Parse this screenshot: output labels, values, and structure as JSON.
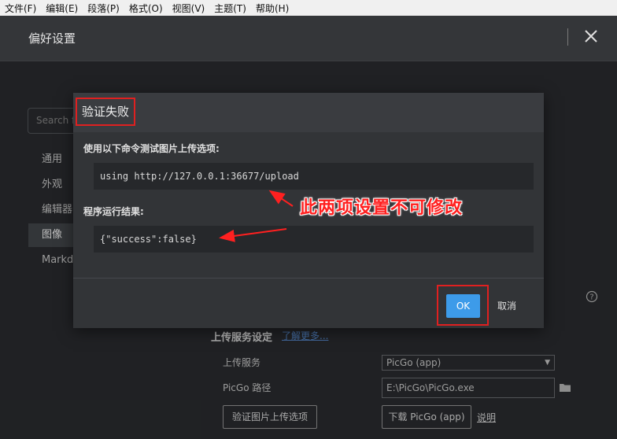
{
  "menu": [
    "文件(F)",
    "编辑(E)",
    "段落(P)",
    "格式(O)",
    "视图(V)",
    "主题(T)",
    "帮助(H)"
  ],
  "prefs": {
    "title": "偏好设置",
    "search_placeholder": "Search f",
    "nav": [
      "通用",
      "外观",
      "编辑器",
      "图像",
      "Markdo"
    ],
    "active_nav": 3
  },
  "upload": {
    "section_title": "上传服务设定",
    "learn_more": "了解更多...",
    "service_label": "上传服务",
    "service_value": "PicGo (app)",
    "path_label": "PicGo 路径",
    "path_value": "E:\\PicGo\\PicGo.exe",
    "verify_button": "验证图片上传选项",
    "download_button": "下载 PicGo (app)",
    "instructions_link": "说明"
  },
  "dialog": {
    "title": "验证失败",
    "command_label": "使用以下命令测试图片上传选项:",
    "command_value": "using http://127.0.0.1:36677/upload",
    "result_label": "程序运行结果:",
    "result_value": "{\"success\":false}",
    "ok_label": "OK",
    "cancel_label": "取消"
  },
  "annotation": {
    "text": "此两项设置不可修改",
    "color": "#ff2020"
  },
  "colors": {
    "accent": "#3d9be9",
    "highlight_box": "#e02020",
    "link": "#5a8fd6"
  }
}
